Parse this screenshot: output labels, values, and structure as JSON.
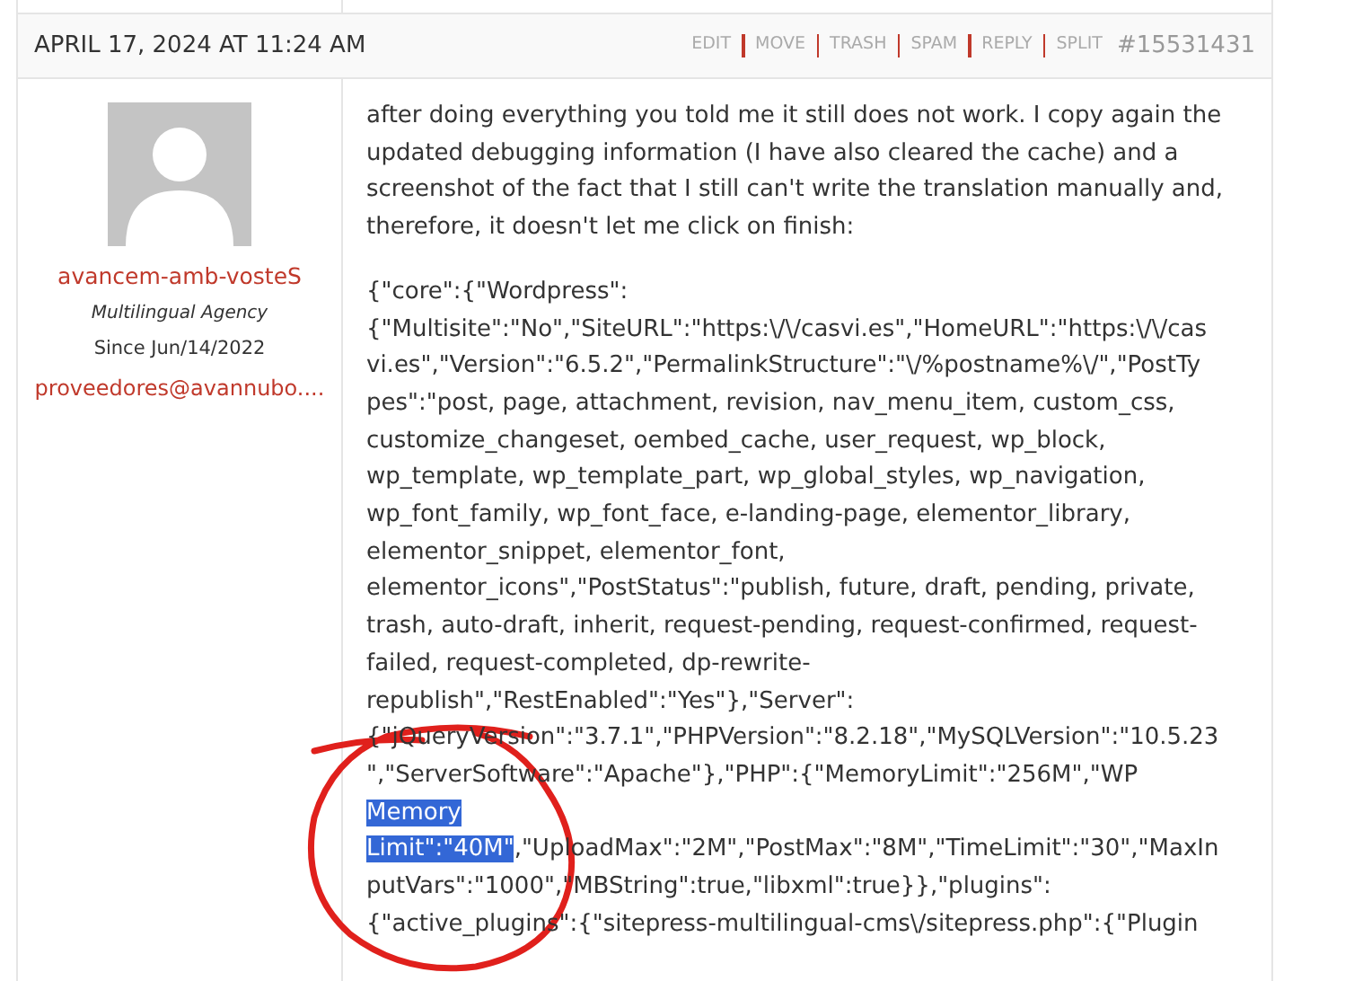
{
  "post": {
    "date": "APRIL 17, 2024 AT 11:24 AM",
    "actions": [
      "EDIT",
      "MOVE",
      "TRASH",
      "SPAM",
      "REPLY",
      "SPLIT"
    ],
    "post_id": "#15531431",
    "author": {
      "name": "avancem-amb-vosteS",
      "role": "Multilingual Agency",
      "since": "Since Jun/14/2022",
      "email": "proveedores@avannubo...."
    },
    "message_lines": [
      "after doing everything you told me it still does not work. I copy again the",
      "updated debugging information (I have also cleared the cache) and a",
      "screenshot of the fact that I still can't write the translation manually and,",
      "therefore, it doesn't let me click on finish:"
    ],
    "debug_lines": [
      [
        {
          "text": "{\"core\":{\"Wordpress\":",
          "selected": false
        }
      ],
      [
        {
          "text": "{\"Multisite\":\"No\",\"SiteURL\":\"https:\\/\\/casvi.es\",\"HomeURL\":\"https:\\/\\/cas",
          "selected": false
        }
      ],
      [
        {
          "text": "vi.es\",\"Version\":\"6.5.2\",\"PermalinkStructure\":\"\\/%postname%\\/\",\"PostTy",
          "selected": false
        }
      ],
      [
        {
          "text": "pes\":\"post, page, attachment, revision, nav_menu_item, custom_css,",
          "selected": false
        }
      ],
      [
        {
          "text": "customize_changeset, oembed_cache, user_request, wp_block,",
          "selected": false
        }
      ],
      [
        {
          "text": "wp_template, wp_template_part, wp_global_styles, wp_navigation,",
          "selected": false
        }
      ],
      [
        {
          "text": "wp_font_family, wp_font_face, e-landing-page, elementor_library,",
          "selected": false
        }
      ],
      [
        {
          "text": "elementor_snippet, elementor_font,",
          "selected": false
        }
      ],
      [
        {
          "text": "elementor_icons\",\"PostStatus\":\"publish, future, draft, pending, private,",
          "selected": false
        }
      ],
      [
        {
          "text": "trash, auto-draft, inherit, request-pending, request-confirmed, request-",
          "selected": false
        }
      ],
      [
        {
          "text": "failed, request-completed, dp-rewrite-",
          "selected": false
        }
      ],
      [
        {
          "text": "republish\",\"RestEnabled\":\"Yes\"},\"Server\":",
          "selected": false
        }
      ],
      [
        {
          "text": "{\"jQueryVersion\":\"3.7.1\",\"PHPVersion\":\"8.2.18\",\"MySQLVersion\":\"10.5.23",
          "selected": false
        }
      ],
      [
        {
          "text": "\",\"ServerSoftware\":\"Apache\"},\"PHP\":{\"MemoryLimit\":\"256M\",\"WP",
          "selected": false
        }
      ],
      [
        {
          "text": "Memory",
          "selected": true
        }
      ],
      [
        {
          "text": "Limit\":\"40M\"",
          "selected": true
        },
        {
          "text": ",\"UploadMax\":\"2M\",\"PostMax\":\"8M\",\"TimeLimit\":\"30\",\"MaxIn",
          "selected": false
        }
      ],
      [
        {
          "text": "putVars\":\"1000\",\"MBString\":true,\"libxml\":true}},\"plugins\":",
          "selected": false
        }
      ],
      [
        {
          "text": "{\"active_plugins\":{\"sitepress-multilingual-cms\\/sitepress.php\":{\"Plugin",
          "selected": false
        }
      ]
    ]
  }
}
